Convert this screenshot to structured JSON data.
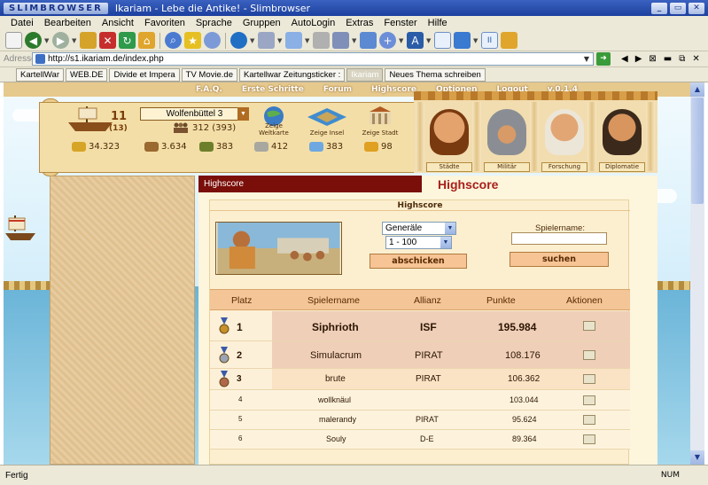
{
  "window": {
    "brand": "SLIMBROWSER",
    "title": "Ikariam - Lebe die Antike! - Slimbrowser",
    "controls": [
      "_",
      "▭",
      "✕"
    ]
  },
  "menu": [
    "Datei",
    "Bearbeiten",
    "Ansicht",
    "Favoriten",
    "Sprache",
    "Gruppen",
    "AutoLogin",
    "Extras",
    "Fenster",
    "Hilfe"
  ],
  "address": {
    "label": "Adresse",
    "url": "http://s1.ikariam.de/index.php"
  },
  "tabs": [
    {
      "label": "KartellWar",
      "active": false
    },
    {
      "label": "WEB.DE",
      "active": false
    },
    {
      "label": "Divide et Impera",
      "active": false
    },
    {
      "label": "TV Movie.de",
      "active": false
    },
    {
      "label": "Kartellwar Zeitungsticker :",
      "active": false
    },
    {
      "label": "Ikariam",
      "active": true
    },
    {
      "label": "Neues Thema schreiben",
      "active": false
    }
  ],
  "status": {
    "text": "Fertig",
    "num": "NUM"
  },
  "game": {
    "nav": [
      "F.A.Q.",
      "Erste Schritte",
      "Forum",
      "Highscore",
      "Optionen",
      "Logout",
      "v.0.1.4"
    ],
    "ships": {
      "count": "11",
      "total": "(13)"
    },
    "city": "Wolfenbüttel 3",
    "population": "312 (393)",
    "view_buttons": [
      "Zeige Weltkarte",
      "Zeige Insel",
      "Zeige Stadt"
    ],
    "resources": {
      "gold": "34.323",
      "wood": "3.634",
      "wine": "383",
      "marble": "412",
      "crystal": "383",
      "sulfur": "98"
    },
    "advisors": [
      "Städte",
      "Militär",
      "Forschung",
      "Diplomatie"
    ],
    "breadcrumb": "Highscore",
    "page_title": "Highscore",
    "box_title": "Highscore",
    "select_category": "Generäle",
    "select_range": "1 - 100",
    "submit_label": "abschicken",
    "player_label": "Spielername:",
    "search_label": "suchen",
    "table": {
      "headers": [
        "Platz",
        "Spielername",
        "Allianz",
        "Punkte",
        "Aktionen"
      ],
      "rows": [
        {
          "rank": "1",
          "name": "Siphrioth",
          "alliance": "ISF",
          "points": "195.984",
          "medal": "gold"
        },
        {
          "rank": "2",
          "name": "Simulacrum",
          "alliance": "PIRAT",
          "points": "108.176",
          "medal": "silver"
        },
        {
          "rank": "3",
          "name": "brute",
          "alliance": "PIRAT",
          "points": "106.362",
          "medal": "bronze"
        },
        {
          "rank": "4",
          "name": "wollknäul",
          "alliance": "",
          "points": "103.044",
          "medal": ""
        },
        {
          "rank": "5",
          "name": "malerandy",
          "alliance": "PIRAT",
          "points": "95.624",
          "medal": ""
        },
        {
          "rank": "6",
          "name": "Souly",
          "alliance": "D-E",
          "points": "89.364",
          "medal": ""
        }
      ]
    }
  },
  "colors": {
    "titlebar": "#1c3f9e",
    "chrome": "#ece9d8",
    "header_red": "#7a0e08",
    "title_red": "#a8201b",
    "table_head": "#f4c596"
  }
}
